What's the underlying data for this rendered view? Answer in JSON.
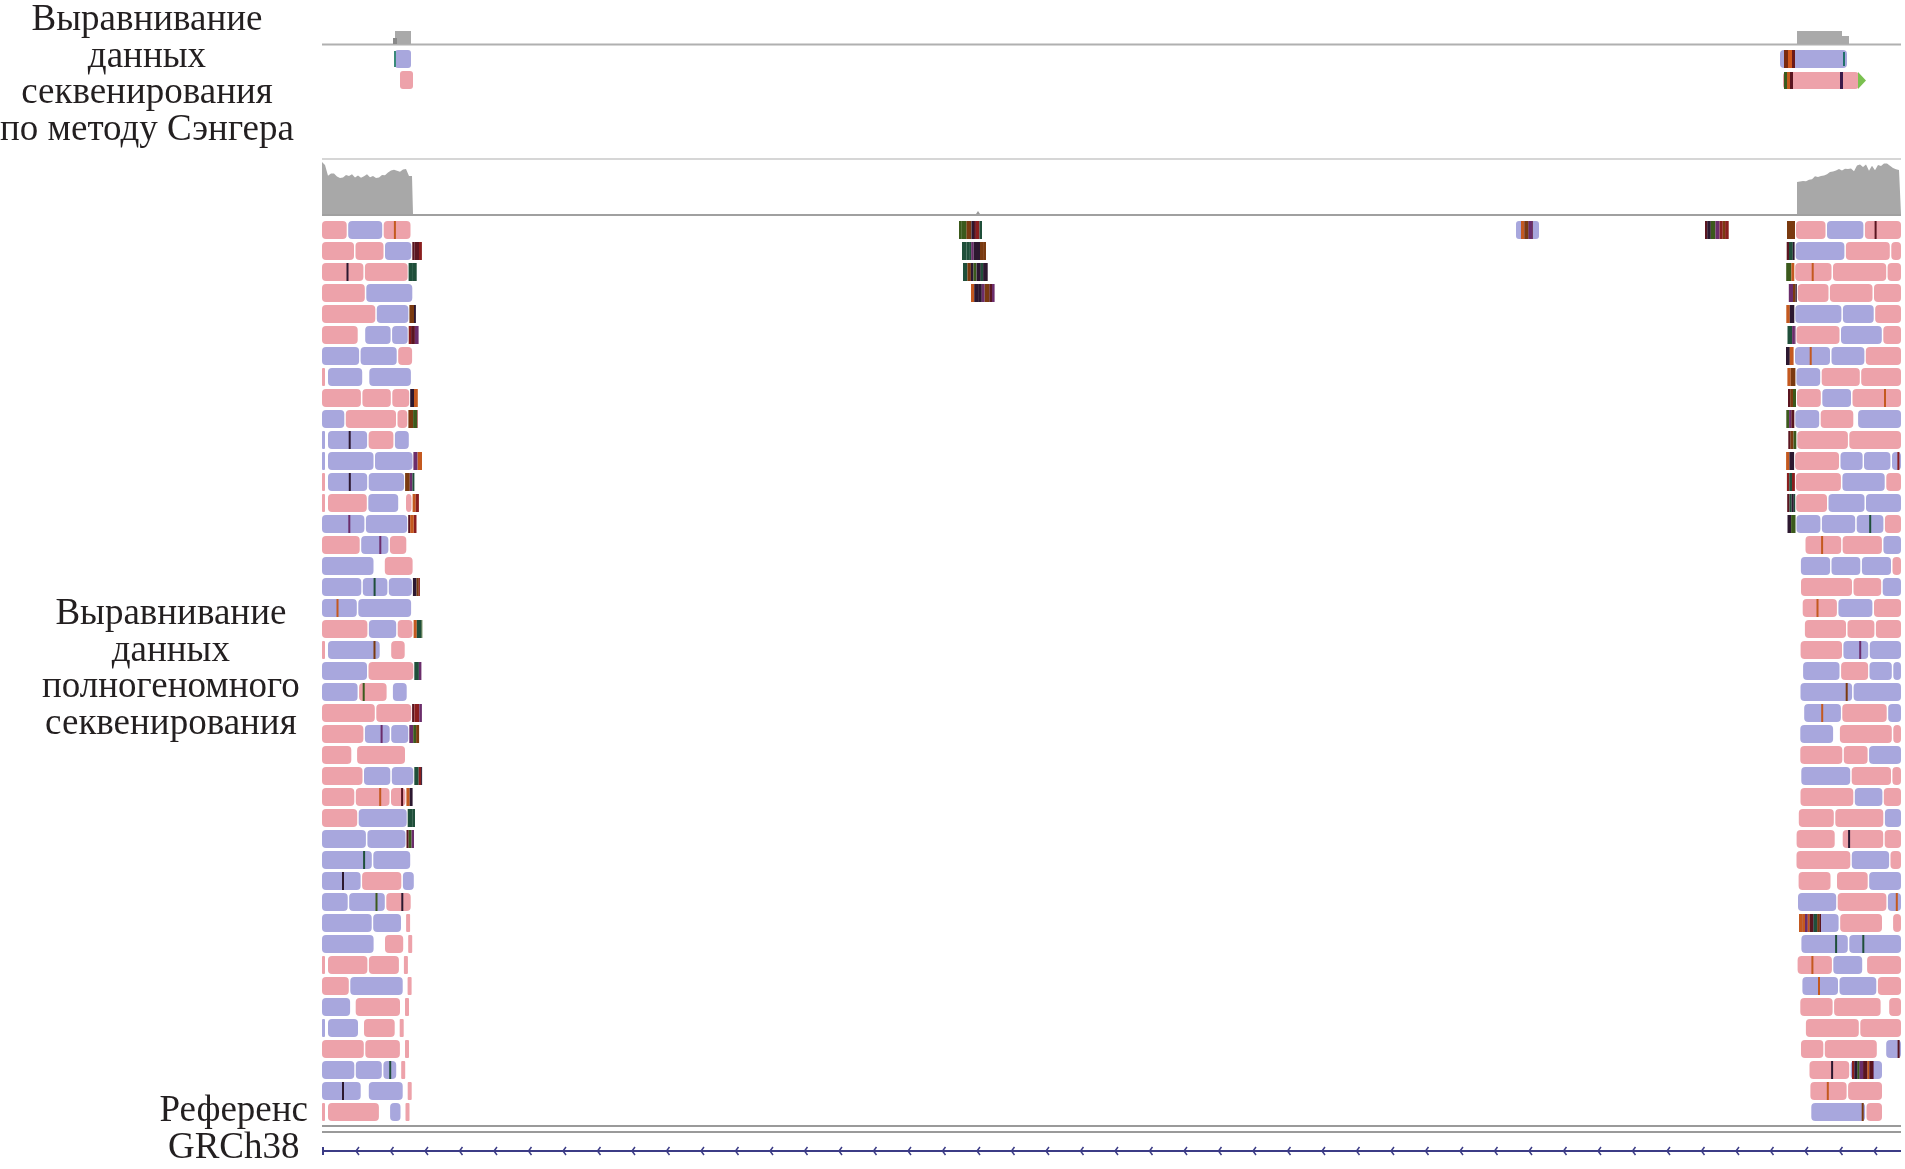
{
  "tracks": [
    {
      "kind": "sanger",
      "label": "Выравнивание\nданных\nсеквенирования\nпо методу Сэнгера"
    },
    {
      "kind": "wgs",
      "label": "Выравнивание\nданных\nполногеномного\nсеквенирования"
    },
    {
      "kind": "reference",
      "label": "Референс\nGRCh38"
    }
  ]
}
